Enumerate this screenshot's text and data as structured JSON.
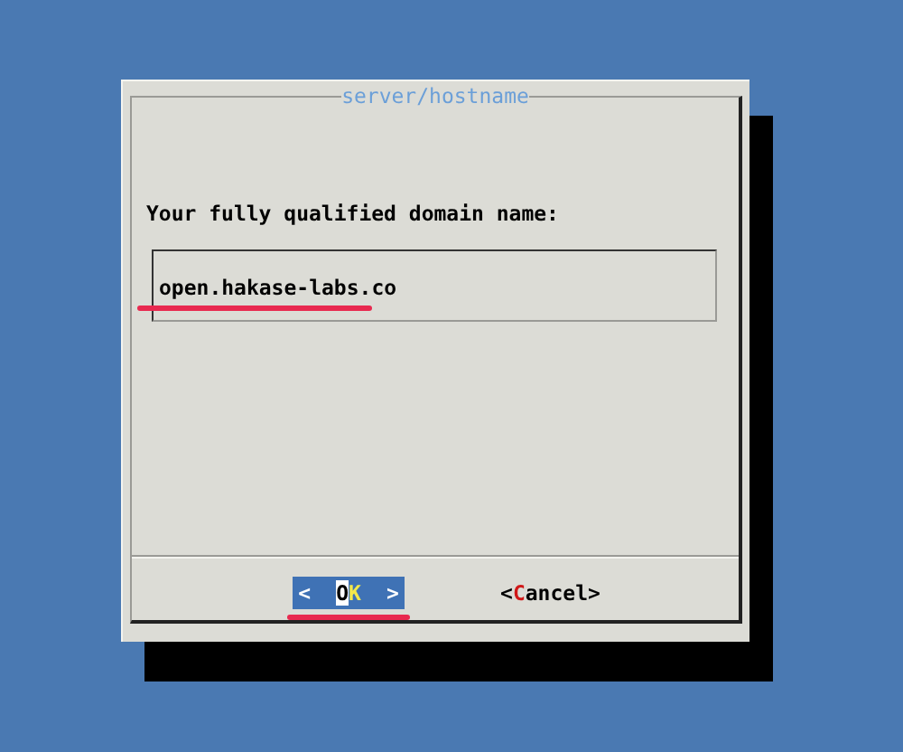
{
  "dialog": {
    "title": "server/hostname",
    "prompt": "Your fully qualified domain name:",
    "field": {
      "value": "open.hakase-labs.co"
    }
  },
  "buttons": [
    {
      "open_bracket": "<",
      "label": "OK",
      "close_bracket": ">",
      "selected": true
    },
    {
      "open_bracket": "<",
      "label": "Cancel",
      "close_bracket": ">",
      "selected": false
    }
  ]
}
